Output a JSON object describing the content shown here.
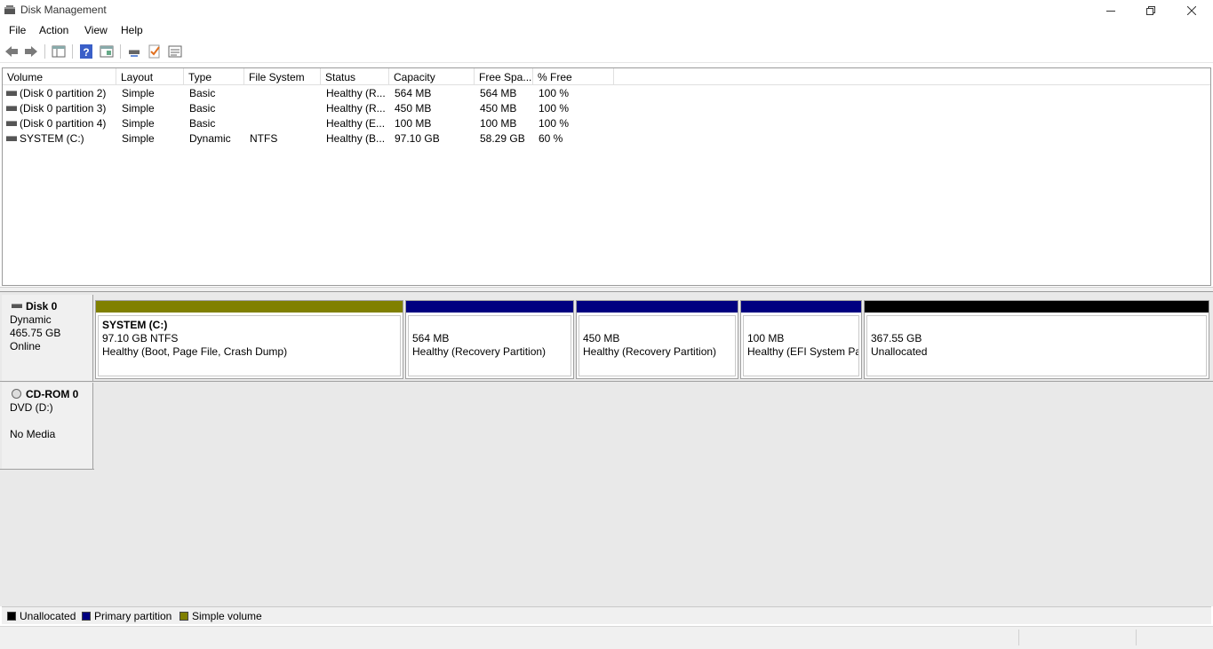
{
  "window": {
    "title": "Disk Management",
    "controls": [
      "minimize",
      "restore",
      "close"
    ]
  },
  "menu": [
    "File",
    "Action",
    "View",
    "Help"
  ],
  "toolbar": {
    "icons": [
      "back-arrow-icon",
      "forward-arrow-icon",
      "console-tree-icon",
      "help-icon",
      "properties-icon",
      "connect-icon",
      "checklist-icon",
      "volume-list-icon"
    ]
  },
  "volume_table": {
    "columns": [
      "Volume",
      "Layout",
      "Type",
      "File System",
      "Status",
      "Capacity",
      "Free Spa...",
      "% Free"
    ],
    "rows": [
      {
        "volume": "(Disk 0 partition 2)",
        "layout": "Simple",
        "type": "Basic",
        "fs": "",
        "status": "Healthy (R...",
        "capacity": "564 MB",
        "free": "564 MB",
        "pct": "100 %"
      },
      {
        "volume": "(Disk 0 partition 3)",
        "layout": "Simple",
        "type": "Basic",
        "fs": "",
        "status": "Healthy (R...",
        "capacity": "450 MB",
        "free": "450 MB",
        "pct": "100 %"
      },
      {
        "volume": "(Disk 0 partition 4)",
        "layout": "Simple",
        "type": "Basic",
        "fs": "",
        "status": "Healthy (E...",
        "capacity": "100 MB",
        "free": "100 MB",
        "pct": "100 %"
      },
      {
        "volume": "SYSTEM (C:)",
        "layout": "Simple",
        "type": "Dynamic",
        "fs": "NTFS",
        "status": "Healthy (B...",
        "capacity": "97.10 GB",
        "free": "58.29 GB",
        "pct": "60 %"
      }
    ]
  },
  "disks": {
    "disk0": {
      "name": "Disk 0",
      "type": "Dynamic",
      "size": "465.75 GB",
      "state": "Online",
      "partitions": [
        {
          "name": "SYSTEM  (C:)",
          "line1": "97.10 GB NTFS",
          "line2": "Healthy (Boot, Page File, Crash Dump)",
          "color": "#808000"
        },
        {
          "name": "",
          "line1": "564 MB",
          "line2": "Healthy (Recovery Partition)",
          "color": "#000080"
        },
        {
          "name": "",
          "line1": "450 MB",
          "line2": "Healthy (Recovery Partition)",
          "color": "#000080"
        },
        {
          "name": "",
          "line1": "100 MB",
          "line2": "Healthy (EFI System Par",
          "color": "#000080"
        },
        {
          "name": "",
          "line1": "367.55 GB",
          "line2": "Unallocated",
          "color": "#000000"
        }
      ]
    },
    "cdrom0": {
      "name": "CD-ROM 0",
      "type": "DVD (D:)",
      "state": "No Media"
    }
  },
  "legend": [
    {
      "label": "Unallocated",
      "color": "#000000"
    },
    {
      "label": "Primary partition",
      "color": "#000080"
    },
    {
      "label": "Simple volume",
      "color": "#808000"
    }
  ]
}
